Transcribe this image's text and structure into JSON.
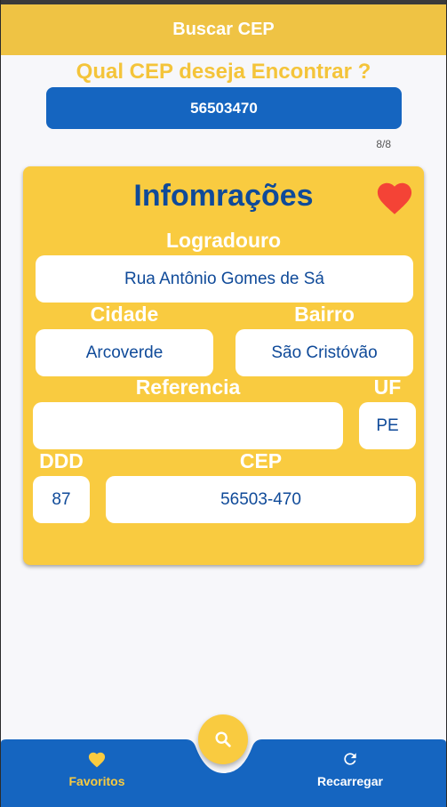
{
  "appbar": {
    "title": "Buscar CEP"
  },
  "search": {
    "question": "Qual CEP deseja Encontrar ?",
    "value": "56503470",
    "counter": "8/8"
  },
  "card": {
    "title": "Infomrações",
    "logradouro_label": "Logradouro",
    "logradouro": "Rua Antônio Gomes de Sá",
    "cidade_label": "Cidade",
    "cidade": "Arcoverde",
    "bairro_label": "Bairro",
    "bairro": "São Cristóvão",
    "referencia_label": "Referencia",
    "referencia": "",
    "uf_label": "UF",
    "uf": "PE",
    "ddd_label": "DDD",
    "ddd": "87",
    "cep_label": "CEP",
    "cep": "56503-470"
  },
  "nav": {
    "favoritos": "Favoritos",
    "recarregar": "Recarregar"
  },
  "icons": {
    "favorite": "heart-icon",
    "search": "search-icon",
    "reload": "refresh-icon"
  },
  "colors": {
    "accent": "#f9cb40",
    "primary": "#1565c0",
    "title_blue": "#0f4a99",
    "heart": "#f44336"
  }
}
